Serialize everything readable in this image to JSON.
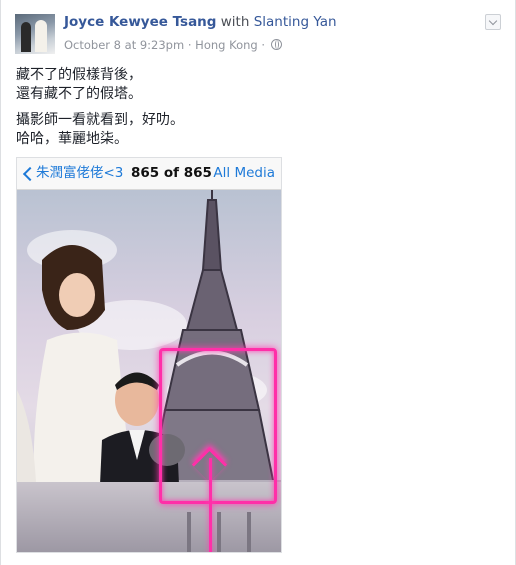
{
  "post": {
    "author": "Joyce Kewyee Tsang",
    "with_text": "with",
    "tagged": "Slanting Yan",
    "date": "October 8 at 9:23pm",
    "separator": "·",
    "location": "Hong Kong",
    "privacy_icon": "globe-icon",
    "text_lines": [
      "藏不了的假樣背後，",
      "還有藏不了的假塔。",
      "攝影師一看就看到，好叻。",
      "哈哈，華麗地柒。"
    ]
  },
  "screenshot": {
    "back_icon": "chevron-left-icon",
    "album_title": "朱潤富佬佬<3",
    "counter": "865 of 865",
    "all_media": "All Media",
    "marker_color": "#ff2fa8"
  },
  "colors": {
    "link": "#365899",
    "ios_blue": "#1e7ad8",
    "meta": "#90949c"
  }
}
